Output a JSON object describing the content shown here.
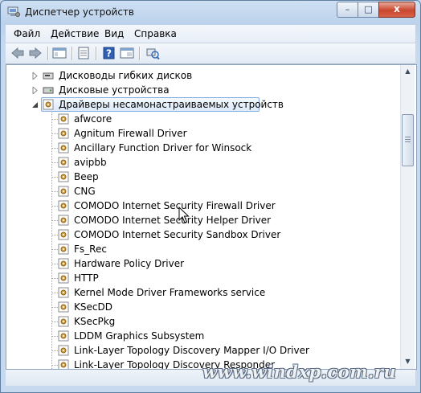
{
  "window": {
    "title": "Диспетчер устройств",
    "buttons": {
      "minimize": "–",
      "maximize": "□",
      "close": "x"
    }
  },
  "menu": [
    "Файл",
    "Действие",
    "Вид",
    "Справка"
  ],
  "toolbar": [
    "back-arrow-icon",
    "forward-arrow-icon",
    "console-tree-icon",
    "properties-icon",
    "help-icon",
    "show-hide-icon",
    "scan-hardware-icon"
  ],
  "tree": {
    "categories": [
      {
        "label": "Дисководы гибких дисков",
        "expanded": false
      },
      {
        "label": "Дисковые устройства",
        "expanded": false
      },
      {
        "label": "Драйверы несамонастраиваемых устройств",
        "expanded": true,
        "selected": true
      }
    ],
    "drivers": [
      "afwcore",
      "Agnitum Firewall Driver",
      "Ancillary Function Driver for Winsock",
      "avipbb",
      "Beep",
      "CNG",
      "COMODO Internet Security Firewall Driver",
      "COMODO Internet Security Helper Driver",
      "COMODO Internet Security Sandbox Driver",
      "Fs_Rec",
      "Hardware Policy Driver",
      "HTTP",
      "Kernel Mode Driver Frameworks service",
      "KSecDD",
      "KSecPkg",
      "LDDM Graphics Subsystem",
      "Link-Layer Topology Discovery Mapper I/O Driver",
      "Link-Layer Topology Discovery Responder"
    ]
  },
  "watermark": "www.windxp.com.ru",
  "colors": {
    "selection_border": "#84acdd",
    "window_frame": "#bcd2ec",
    "close_button": "#c9472e"
  }
}
